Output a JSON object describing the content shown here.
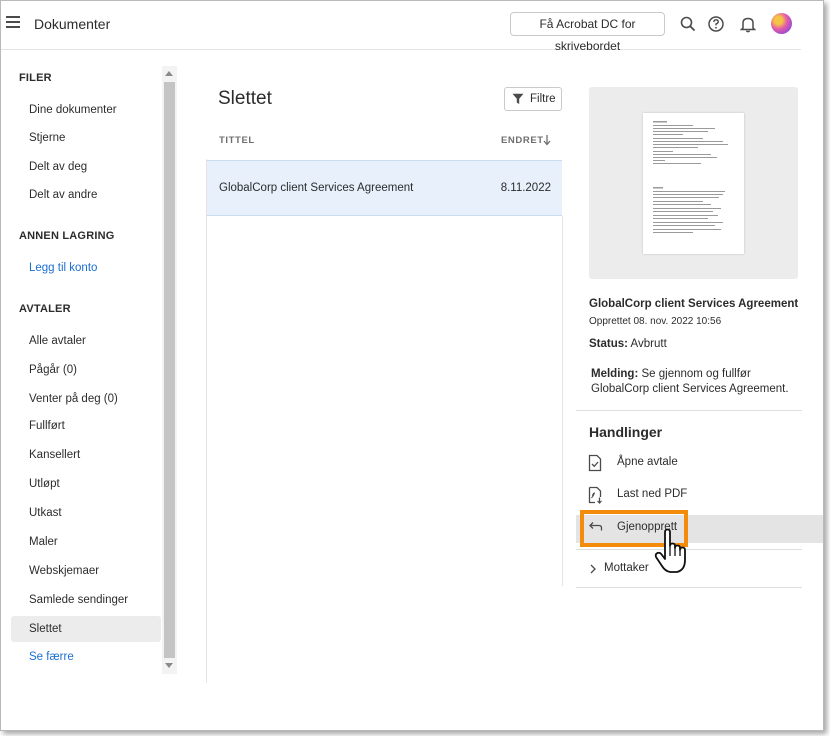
{
  "header": {
    "app_title": "Dokumenter",
    "promo_label": "Få Acrobat DC for skrivebordet",
    "icons": [
      "menu-icon",
      "search-icon",
      "help-icon",
      "bell-icon",
      "avatar"
    ]
  },
  "sidebar": {
    "files_heading": "FILER",
    "files_items": [
      "Dine dokumenter",
      "Stjerne",
      "Delt av deg",
      "Delt av andre"
    ],
    "storage_heading": "ANNEN LAGRING",
    "storage_link": "Legg til konto",
    "agreements_heading": "AVTALER",
    "agreements_items": [
      "Alle avtaler",
      "Pågår (0)",
      "Venter på deg (0)",
      "Fullført",
      "Kansellert",
      "Utløpt",
      "Utkast",
      "Maler",
      "Webskjemaer",
      "Samlede sendinger",
      "Slettet"
    ],
    "active_item": "Slettet",
    "show_less": "Se færre"
  },
  "main": {
    "title": "Slettet",
    "filter_label": "Filtre",
    "col_title": "TITTEL",
    "col_modified": "ENDRET",
    "rows": [
      {
        "title": "GlobalCorp client Services Agreement",
        "date": "8.11.2022"
      }
    ]
  },
  "details": {
    "doc_title": "GlobalCorp client Services Agreement",
    "created": "Opprettet 08. nov. 2022 10:56",
    "status_label": "Status:",
    "status_value": "Avbrutt",
    "message_label": "Melding:",
    "message_value": "Se gjennom og fullfør GlobalCorp client Services Agreement.",
    "actions_heading": "Handlinger",
    "actions": [
      {
        "label": "Åpne avtale",
        "icon": "open-agreement-icon"
      },
      {
        "label": "Last ned PDF",
        "icon": "download-pdf-icon"
      },
      {
        "label": "Gjenopprett",
        "icon": "restore-icon"
      }
    ],
    "recipient_label": "Mottaker"
  },
  "colors": {
    "accent_link": "#1a6fd1",
    "highlight_orange": "#f28c0a",
    "selected_row": "#e7f0fb"
  }
}
